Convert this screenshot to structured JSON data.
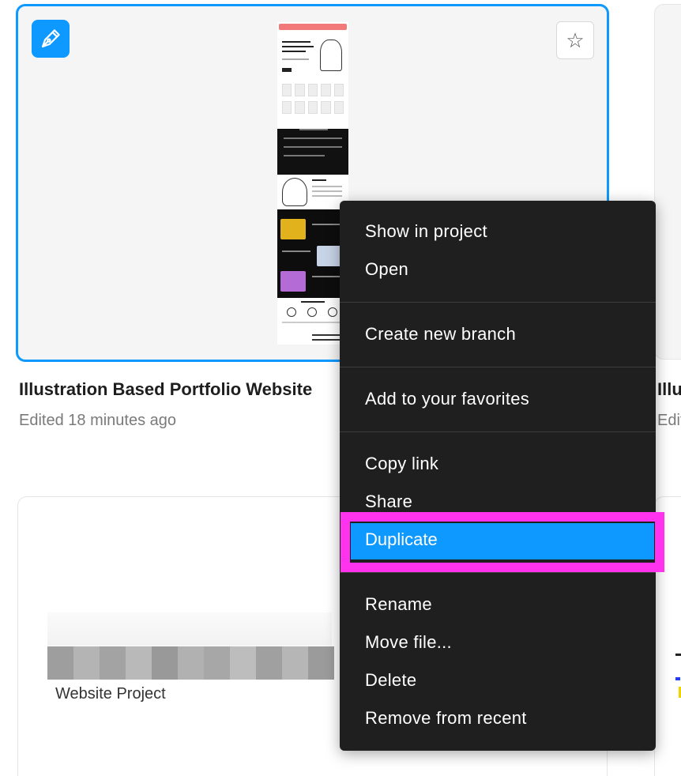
{
  "files": {
    "card1": {
      "title": "Illustration Based Portfolio Website",
      "subtitle": "Edited 18 minutes ago",
      "type_icon": "pen-icon",
      "favorite_icon": "star-icon"
    },
    "card_right": {
      "title": "Illustration",
      "subtitle": "Edited"
    },
    "card2": {
      "caption": "Website Project"
    }
  },
  "context_menu": {
    "groups": [
      [
        "Show in project",
        "Open"
      ],
      [
        "Create new branch"
      ],
      [
        "Add to your favorites"
      ],
      [
        "Copy link",
        "Share",
        "Duplicate"
      ],
      [
        "Rename",
        "Move file...",
        "Delete",
        "Remove from recent"
      ]
    ],
    "items": {
      "show_in_project": "Show in project",
      "open": "Open",
      "create_new_branch": "Create new branch",
      "add_to_favorites": "Add to your favorites",
      "copy_link": "Copy link",
      "share": "Share",
      "duplicate": "Duplicate",
      "rename": "Rename",
      "move_file": "Move file...",
      "delete": "Delete",
      "remove_from_recent": "Remove from recent"
    },
    "highlighted_item": "Duplicate"
  },
  "colors": {
    "accent": "#0d99ff",
    "menu_bg": "#1f1f1f",
    "highlight_outline": "#ff33ee"
  }
}
